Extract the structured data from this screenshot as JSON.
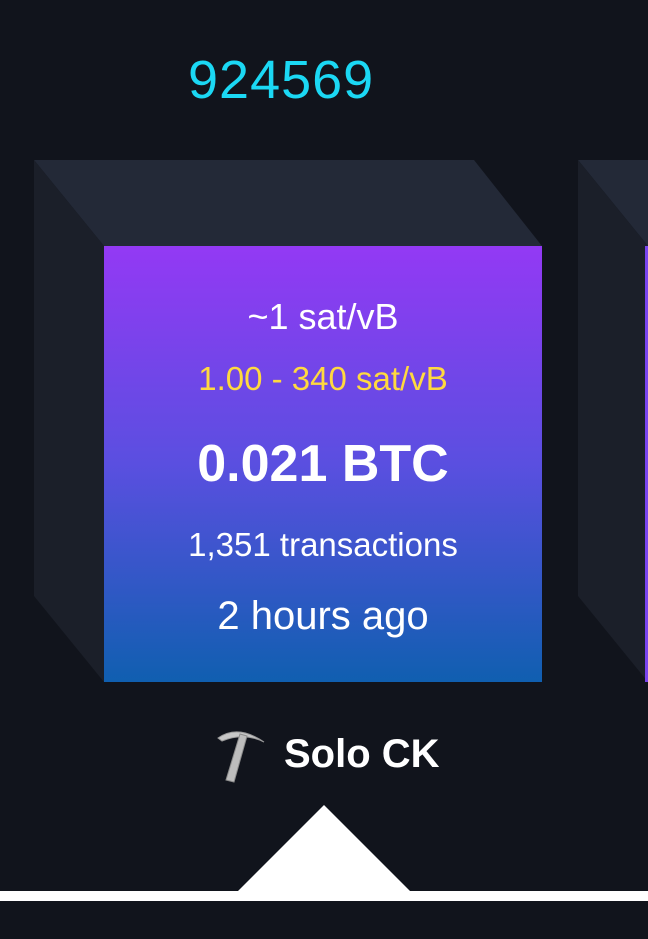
{
  "block": {
    "height": "924569",
    "median_fee": "~1 sat/vB",
    "fee_range": "1.00 - 340 sat/vB",
    "total_fees": "0.021 BTC",
    "tx_count": "1,351 transactions",
    "time_ago": "2 hours ago"
  },
  "pool": {
    "name": "Solo CK",
    "icon": "pickaxe-icon"
  },
  "colors": {
    "background": "#11141c",
    "height_link": "#1bd8f4",
    "fee_range": "#ffd93f",
    "gradient_top": "#9339f4",
    "gradient_bottom": "#105fb0"
  }
}
